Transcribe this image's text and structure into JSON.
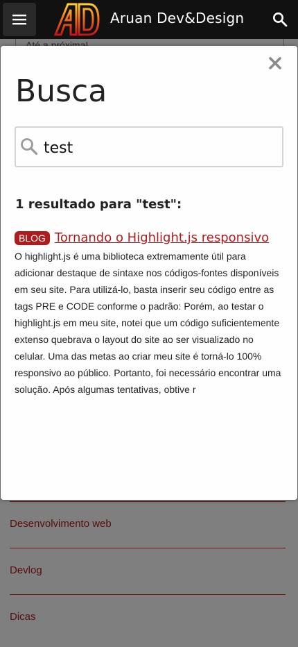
{
  "header": {
    "site_title": "Aruan Dev&Design",
    "logo_text": "AD",
    "menu_icon": "hamburger-icon",
    "search_icon": "search-icon"
  },
  "background": {
    "peek_text": "Até a próxima!",
    "list_items": [
      "Desenvolvimento web",
      "Devlog",
      "Dicas"
    ]
  },
  "modal": {
    "title": "Busca",
    "close_icon": "close-icon",
    "search": {
      "value": "test",
      "placeholder": ""
    },
    "results_count": "1 resultado para \"test\":",
    "results": [
      {
        "badge": "BLOG",
        "title": "Tornando o Highlight.js responsivo",
        "excerpt": "O highlight.js é uma biblioteca extremamente útil para adicionar destaque de sintaxe nos códigos-fontes disponíveis em seu site. Para utilizá-lo, basta inserir seu código entre as tags PRE e CODE conforme o padrão: Porém, ao testar o highlight.js em meu site, notei que um código suficientemente extenso quebrava o layout do site ao ser visualizado no celular. Uma das metas ao criar meu site é torná-lo 100% responsivo ao público. Portanto, foi necessário encontrar uma solução. Após algumas tentativas, obtive r"
      }
    ]
  },
  "colors": {
    "accent": "#b01c1c",
    "topbar": "#111111",
    "overlay": "#7f7f7f"
  }
}
